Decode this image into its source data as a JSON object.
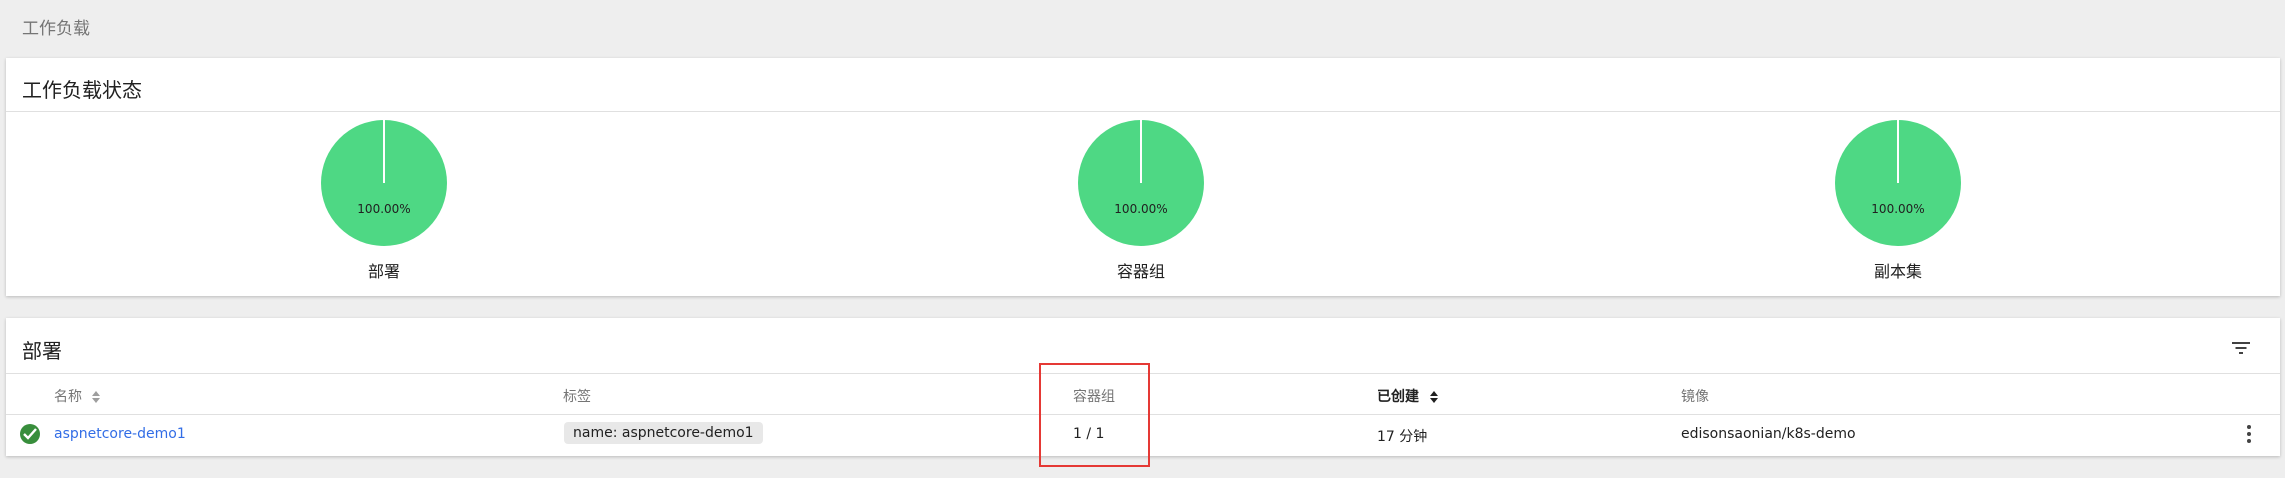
{
  "breadcrumb": "工作负载",
  "status_card": {
    "title": "工作负载状态",
    "charts": [
      {
        "label": "部署",
        "percent_text": "100.00%"
      },
      {
        "label": "容器组",
        "percent_text": "100.00%"
      },
      {
        "label": "副本集",
        "percent_text": "100.00%"
      }
    ]
  },
  "chart_data": [
    {
      "type": "pie",
      "title": "部署",
      "values": [
        100
      ],
      "labels": [
        "100.00%"
      ],
      "colors": [
        "#4ed884"
      ]
    },
    {
      "type": "pie",
      "title": "容器组",
      "values": [
        100
      ],
      "labels": [
        "100.00%"
      ],
      "colors": [
        "#4ed884"
      ]
    },
    {
      "type": "pie",
      "title": "副本集",
      "values": [
        100
      ],
      "labels": [
        "100.00%"
      ],
      "colors": [
        "#4ed884"
      ]
    }
  ],
  "deploy_card": {
    "title": "部署",
    "filter_icon": "filter-icon",
    "columns": {
      "name": "名称",
      "labels": "标签",
      "pods": "容器组",
      "created": "已创建",
      "image": "镜像"
    },
    "rows": [
      {
        "status_icon": "check-circle-icon",
        "name": "aspnetcore-demo1",
        "label_chip": "name: aspnetcore-demo1",
        "pods": "1 / 1",
        "created": "17 分钟",
        "image": "edisonsaonian/k8s-demo",
        "menu_icon": "more-vert-icon"
      }
    ]
  },
  "colors": {
    "pie_fill": "#4ed884",
    "link": "#326de6",
    "status_ok": "#388e3c",
    "highlight_border": "#e53935"
  }
}
